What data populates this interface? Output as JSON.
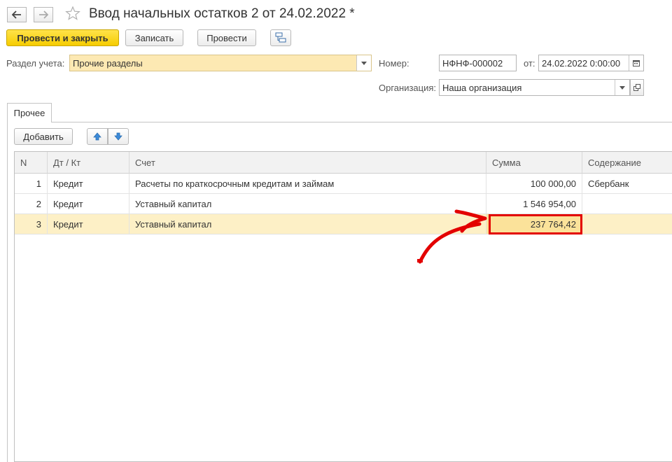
{
  "window": {
    "title": "Ввод начальных остатков 2 от 24.02.2022 *"
  },
  "toolbar": {
    "post_and_close": "Провести и закрыть",
    "save": "Записать",
    "post": "Провести"
  },
  "form": {
    "section_label": "Раздел учета:",
    "section_value": "Прочие разделы",
    "number_label": "Номер:",
    "number_value": "НФНФ-000002",
    "date_label": "от:",
    "date_value": "24.02.2022  0:00:00",
    "org_label": "Организация:",
    "org_value": "Наша организация"
  },
  "tabs": [
    {
      "label": "Прочее"
    }
  ],
  "table_toolbar": {
    "add": "Добавить"
  },
  "table": {
    "columns": [
      "N",
      "Дт / Кт",
      "Счет",
      "Сумма",
      "Содержание"
    ],
    "rows": [
      {
        "n": "1",
        "dtkt": "Кредит",
        "account": "Расчеты по краткосрочным кредитам и займам",
        "sum": "100 000,00",
        "content": "Сбербанк"
      },
      {
        "n": "2",
        "dtkt": "Кредит",
        "account": "Уставный капитал",
        "sum": "1 546 954,00",
        "content": ""
      },
      {
        "n": "3",
        "dtkt": "Кредит",
        "account": "Уставный капитал",
        "sum": "237 764,42",
        "content": ""
      }
    ]
  },
  "colors": {
    "accent_yellow": "#f6cc00",
    "selected_row": "#fdf0c6",
    "highlight_red": "#e30000"
  }
}
